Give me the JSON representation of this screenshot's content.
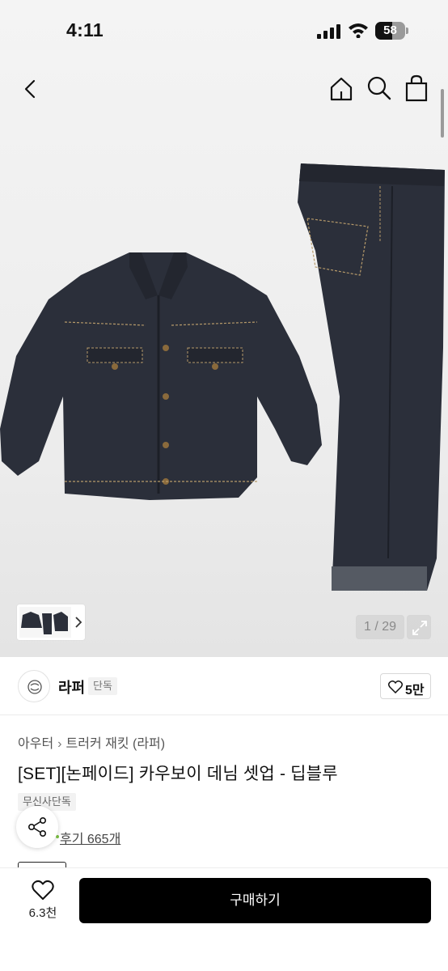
{
  "status_bar": {
    "time": "4:11",
    "battery": "58",
    "battery_level": 0.58
  },
  "nav": {
    "back_icon": "chevron-left-icon",
    "home_icon": "home-icon",
    "search_icon": "search-icon",
    "cart_icon": "shopping-bag-icon"
  },
  "gallery": {
    "counter": "1 / 29",
    "expand_icon": "expand-arrows-icon"
  },
  "brand": {
    "name": "라퍼",
    "badge": "단독",
    "like_count": "5만"
  },
  "product": {
    "breadcrumb": [
      "아우터",
      "트러커 재킷 (라퍼)"
    ],
    "title": "[SET][논페이드] 카우보이 데님 셋업 - 딥블루",
    "exclusive_tag": "무신사단독",
    "reviews": "후기 665개"
  },
  "bottom_bar": {
    "wish_count": "6.3천",
    "buy_label": "구매하기"
  },
  "colors": {
    "denim": "#2b2f3a",
    "stitch": "#b69a6a",
    "accent_black": "#000000"
  }
}
